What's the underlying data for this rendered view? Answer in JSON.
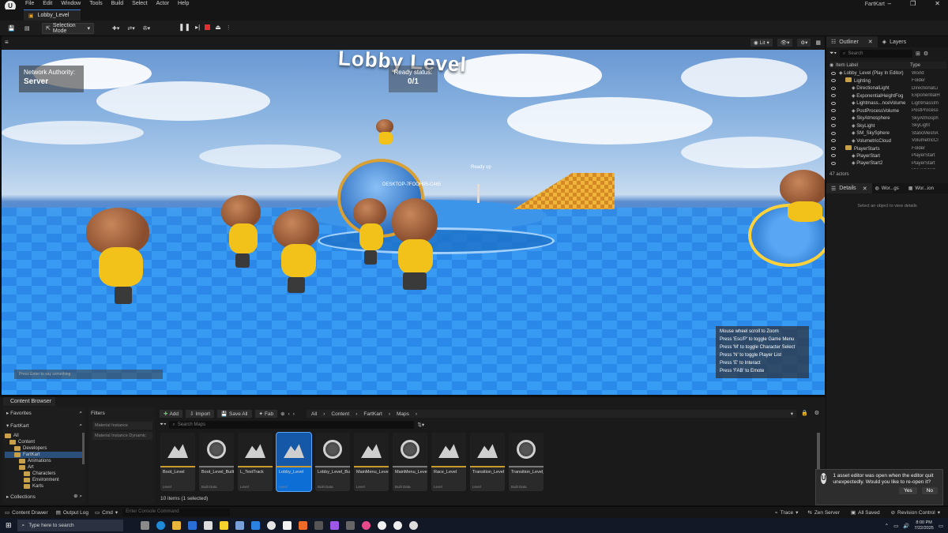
{
  "app": {
    "window_title": "FartKart",
    "logo": "unreal-engine-logo",
    "menu": [
      "File",
      "Edit",
      "Window",
      "Tools",
      "Build",
      "Select",
      "Actor",
      "Help"
    ],
    "level_tab": "Lobby_Level"
  },
  "toolbar": {
    "selection_mode": "Selection Mode"
  },
  "viewport": {
    "view_mode": "Lit",
    "network_label": "Network Authority:",
    "network_value": "Server",
    "ready_label": "Ready status:",
    "ready_value": "0/1",
    "title": "Lobby Level",
    "player_name": "DESKTOP-7FOOH95-C465",
    "ready_up": "Ready up",
    "chat_placeholder": "Press Enter to say something",
    "hints": [
      "Mouse wheel scroll to Zoom",
      "Press 'Esc/P' to toggle Game Menu",
      "Press 'M' to toggle Character Select",
      "Press 'N' to toggle Player List",
      "Press 'E' to Interact",
      "Press 'FAB' to Emote"
    ]
  },
  "outliner": {
    "tab_outliner": "Outliner",
    "tab_layers": "Layers",
    "search_placeholder": "Search",
    "col_label": "Item Label",
    "col_type": "Type",
    "rows": [
      {
        "label": "Lobby_Level (Play In Editor)",
        "type": "World"
      },
      {
        "label": "Lighting",
        "type": "Folder"
      },
      {
        "label": "DirectionalLight",
        "type": "DirectionalLi"
      },
      {
        "label": "ExponentialHeightFog",
        "type": "ExponentialH"
      },
      {
        "label": "Lightmass...nceVolume",
        "type": "LightmassIm"
      },
      {
        "label": "PostProcessVolume",
        "type": "PostProcess"
      },
      {
        "label": "SkyAtmosphere",
        "type": "SkyAtmosph"
      },
      {
        "label": "SkyLight",
        "type": "SkyLight"
      },
      {
        "label": "SM_SkySphere",
        "type": "StaticMeshA"
      },
      {
        "label": "VolumetricCloud",
        "type": "VolumetricCl"
      },
      {
        "label": "PlayerStarts",
        "type": "Folder"
      },
      {
        "label": "PlayerStart",
        "type": "PlayerStart"
      },
      {
        "label": "PlayerStart2",
        "type": "PlayerStart"
      },
      {
        "label": "PlayerStart3",
        "type": "PlayerStart"
      }
    ],
    "actor_count": "47 actors"
  },
  "details": {
    "tab_details": "Details",
    "tab_world": "Wor...gs",
    "tab_world2": "Wor...ion",
    "empty_text": "Select an object to view details"
  },
  "content_browser": {
    "tab": "Content Browser",
    "favorites": "Favorites",
    "root": "FartKart",
    "tree": [
      {
        "label": "All",
        "depth": 0
      },
      {
        "label": "Content",
        "depth": 1
      },
      {
        "label": "Developers",
        "depth": 2
      },
      {
        "label": "FartKart",
        "depth": 2
      },
      {
        "label": "Animations",
        "depth": 3
      },
      {
        "label": "Art",
        "depth": 3
      },
      {
        "label": "Characters",
        "depth": 4
      },
      {
        "label": "Environment",
        "depth": 4
      },
      {
        "label": "Karts",
        "depth": 4
      }
    ],
    "collections": "Collections",
    "filters_label": "Filters",
    "filters": [
      "Material Instance",
      "Material Instance Dynamic"
    ],
    "add": "Add",
    "import": "Import",
    "save_all": "Save All",
    "fab": "Fab",
    "path": [
      "All",
      "Content",
      "FartKart",
      "Maps"
    ],
    "search_placeholder": "Search Maps",
    "assets": [
      {
        "name": "Boot_Level",
        "icon": "level-icon",
        "sub": "Level"
      },
      {
        "name": "Boot_Level_BuiltData",
        "icon": "sphere-icon",
        "sub": "Built Data"
      },
      {
        "name": "L_TestTrack",
        "icon": "level-icon",
        "sub": "Level"
      },
      {
        "name": "Lobby_Level",
        "icon": "level-icon",
        "sub": "Level",
        "selected": true
      },
      {
        "name": "Lobby_Level_BuiltData",
        "icon": "sphere-icon",
        "sub": "Built Data"
      },
      {
        "name": "MainMenu_Level",
        "icon": "level-icon",
        "sub": "Level"
      },
      {
        "name": "MainMenu_Level_BuiltData",
        "icon": "sphere-icon",
        "sub": "Built Data"
      },
      {
        "name": "Race_Level",
        "icon": "level-icon",
        "sub": "Level"
      },
      {
        "name": "Transition_Level",
        "icon": "level-icon",
        "sub": "Level"
      },
      {
        "name": "Transition_Level_BuiltData",
        "icon": "sphere-icon",
        "sub": "Built Data"
      }
    ],
    "status": "10 items (1 selected)"
  },
  "notification": {
    "text": "1 asset editor was open when the editor quit unexpectedly. Would you like to re-open it?",
    "yes": "Yes",
    "no": "No"
  },
  "statusbar": {
    "content_drawer": "Content Drawer",
    "output_log": "Output Log",
    "cmd": "Cmd",
    "console_placeholder": "Enter Console Command",
    "trace": "Trace",
    "zen": "Zen Server",
    "saved": "All Saved",
    "revision": "Revision Control"
  },
  "taskbar": {
    "search_placeholder": "Type here to search",
    "time": "8:00 PM",
    "date": "7/22/2025"
  },
  "colors": {
    "accent": "#0d6fd6",
    "level_stripe": "#c99a2c"
  }
}
